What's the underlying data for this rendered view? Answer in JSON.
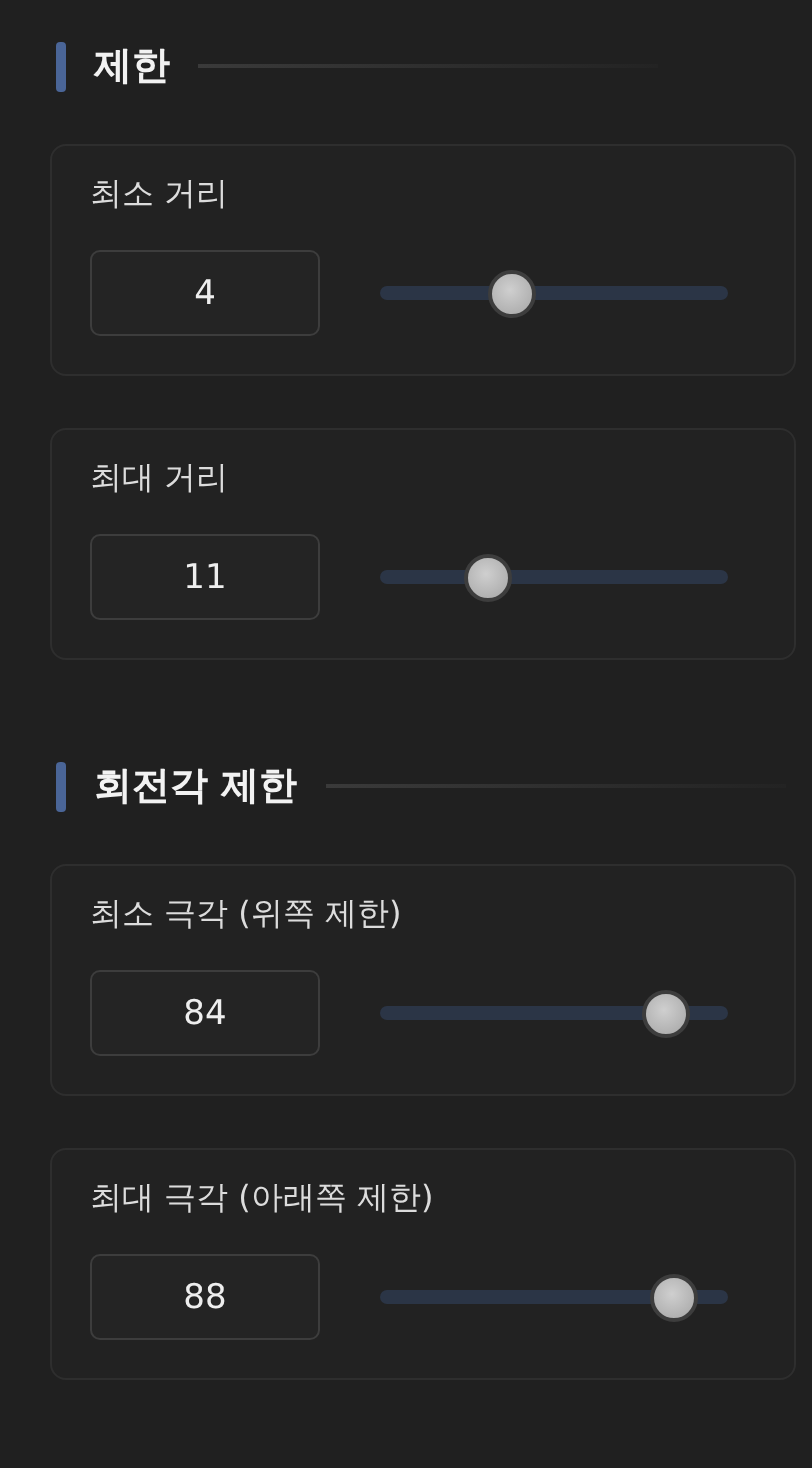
{
  "sections": [
    {
      "title": "제한",
      "settings": [
        {
          "label": "최소 거리",
          "value": "4",
          "level": 0.36
        },
        {
          "label": "최대 거리",
          "value": "11",
          "level": 0.28
        }
      ]
    },
    {
      "title": "회전각 제한",
      "settings": [
        {
          "label": "최소 극각 (위쪽 제한)",
          "value": "84",
          "level": 0.87
        },
        {
          "label": "최대 극각 (아래쪽 제한)",
          "value": "88",
          "level": 0.9
        }
      ]
    }
  ]
}
